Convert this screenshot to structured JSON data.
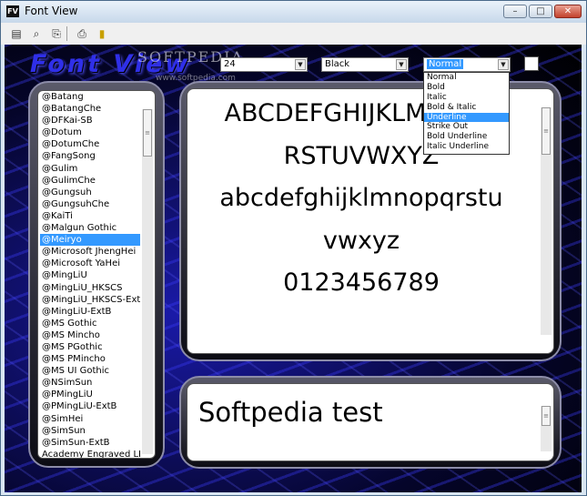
{
  "window": {
    "title": "Font View",
    "icon_text": "FV",
    "minimize_glyph": "–",
    "maximize_glyph": "□",
    "close_glyph": "✕"
  },
  "toolbar": {
    "buttons": [
      {
        "name": "new-icon",
        "glyph": "▤"
      },
      {
        "name": "find-icon",
        "glyph": "⌕"
      },
      {
        "name": "copy-icon",
        "glyph": "⎘"
      },
      {
        "name": "print-icon",
        "glyph": "⎙"
      },
      {
        "name": "exit-icon",
        "glyph": "▮"
      }
    ]
  },
  "branding": {
    "logo": "Font View",
    "watermark": "SOFTPEDIA",
    "watermark_url": "www.softpedia.com"
  },
  "controls": {
    "size_value": "24",
    "color_value": "Black",
    "style_value": "Normal",
    "style_options": [
      "Normal",
      "Bold",
      "Italic",
      "Bold & Italic",
      "Underline",
      "Strike Out",
      "Bold Underline",
      "Italic Underline"
    ],
    "style_highlighted_index": 4
  },
  "font_list": {
    "items": [
      "@Batang",
      "@BatangChe",
      "@DFKai-SB",
      "@Dotum",
      "@DotumChe",
      "@FangSong",
      "@Gulim",
      "@GulimChe",
      "@Gungsuh",
      "@GungsuhChe",
      "@KaiTi",
      "@Malgun Gothic",
      "@Meiryo",
      "@Microsoft JhengHei",
      "@Microsoft YaHei",
      "@MingLiU",
      "@MingLiU_HKSCS",
      "@MingLiU_HKSCS-ExtB",
      "@MingLiU-ExtB",
      "@MS Gothic",
      "@MS Mincho",
      "@MS PGothic",
      "@MS PMincho",
      "@MS UI Gothic",
      "@NSimSun",
      "@PMingLiU",
      "@PMingLiU-ExtB",
      "@SimHei",
      "@SimSun",
      "@SimSun-ExtB",
      "Academy Engraved LET"
    ],
    "selected_index": 12
  },
  "preview": {
    "lines": [
      "ABCDEFGHIJKLMNOPQ",
      "RSTUVWXYZ",
      "abcdefghijklmnopqrstu",
      "vwxyz",
      "0123456789"
    ]
  },
  "sample": {
    "text": "Softpedia test"
  },
  "colors": {
    "selection": "#3399ff",
    "logo": "#2f2fe8"
  }
}
